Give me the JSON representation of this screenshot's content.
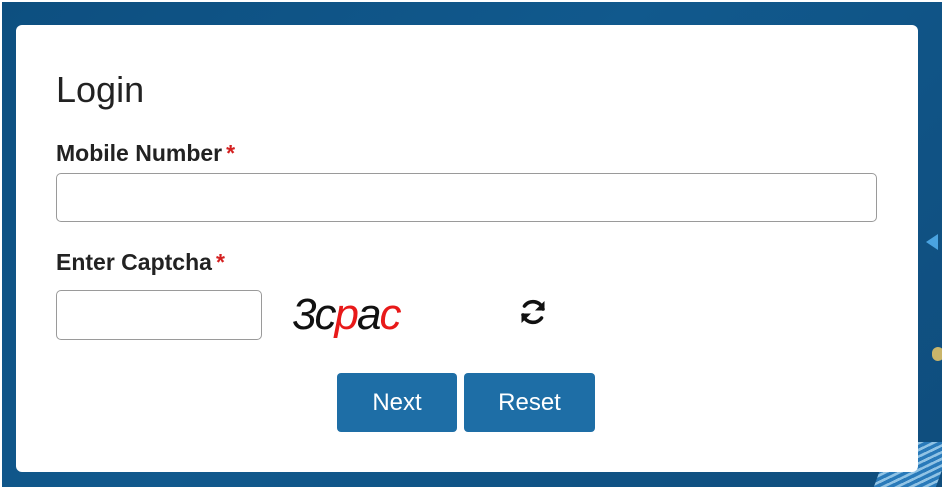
{
  "form": {
    "title": "Login",
    "mobile": {
      "label": "Mobile Number",
      "required_mark": "*",
      "value": ""
    },
    "captcha": {
      "label": "Enter Captcha",
      "required_mark": "*",
      "value": "",
      "image_text_black_1": "3c",
      "image_text_red_1": "p",
      "image_text_black_2": "a",
      "image_text_red_2": "c",
      "refresh_icon": "refresh-icon"
    },
    "buttons": {
      "next_label": "Next",
      "reset_label": "Reset"
    }
  },
  "colors": {
    "background": "#11598d",
    "button": "#1e6ea6",
    "required": "#d42020",
    "captcha_red": "#e81919"
  }
}
